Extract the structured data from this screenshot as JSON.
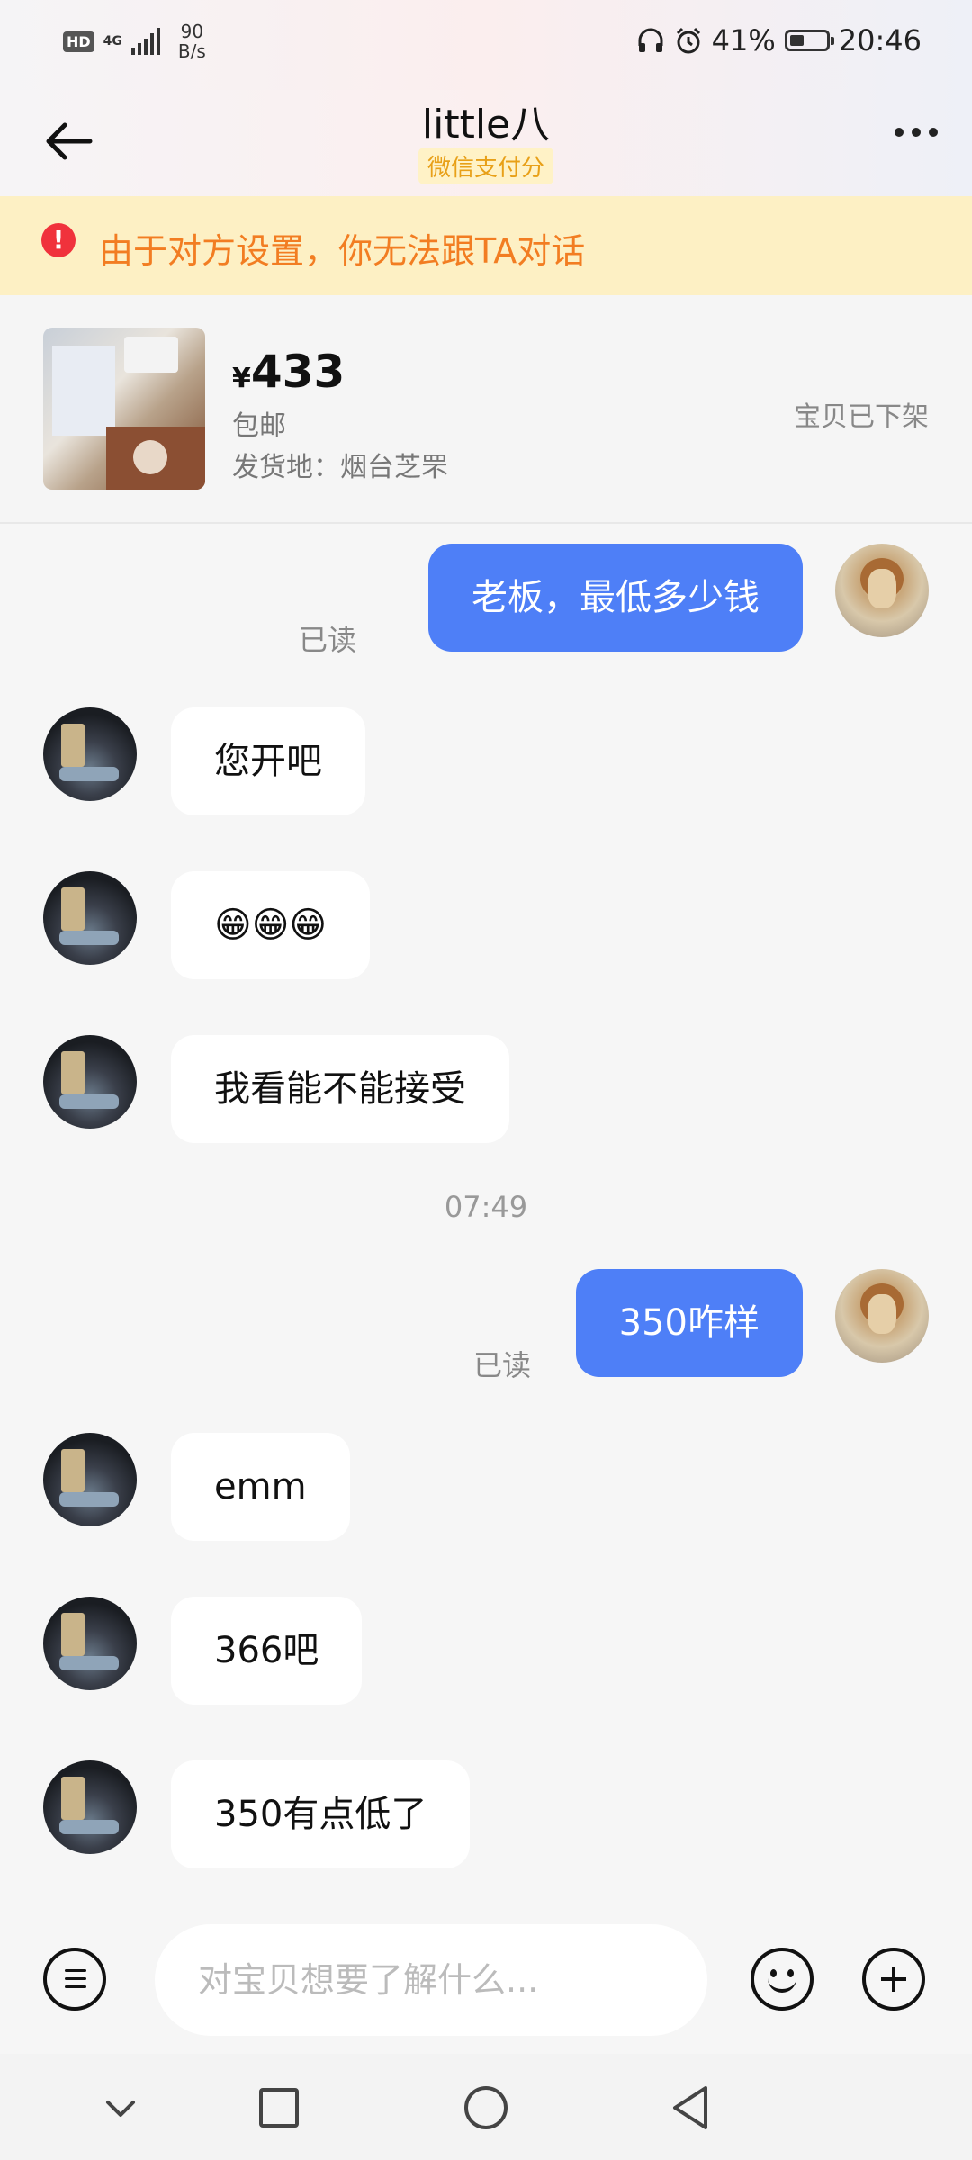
{
  "status_bar": {
    "hd": "HD",
    "network": "4G",
    "speed_value": "90",
    "speed_unit": "B/s",
    "battery_percent": "41%",
    "battery_level": 0.41,
    "time": "20:46"
  },
  "header": {
    "title": "little八",
    "badge": "微信支付分"
  },
  "warning": {
    "icon_text": "!",
    "text": "由于对方设置，你无法跟TA对话"
  },
  "product": {
    "currency": "¥",
    "price": "433",
    "shipping": "包邮",
    "ship_from": "发货地：烟台芝罘",
    "status": "宝贝已下架"
  },
  "messages": [
    {
      "sender": "self",
      "text": "老板，最低多少钱",
      "read": "已读"
    },
    {
      "sender": "other",
      "text": "您开吧"
    },
    {
      "sender": "other",
      "text": "😁😁😁"
    },
    {
      "sender": "other",
      "text": "我看能不能接受"
    },
    {
      "type": "time",
      "text": "07:49"
    },
    {
      "sender": "self",
      "text": "350咋样",
      "read": "已读"
    },
    {
      "sender": "other",
      "text": "emm"
    },
    {
      "sender": "other",
      "text": "366吧"
    },
    {
      "sender": "other",
      "text": "350有点低了"
    }
  ],
  "input": {
    "placeholder": "对宝贝想要了解什么..."
  },
  "icons": {
    "back": "back-arrow-icon",
    "more": "more-dots-icon",
    "menu": "menu-list-icon",
    "emoji": "emoji-icon",
    "plus": "plus-icon",
    "nav_down": "chevron-down-icon",
    "nav_recent": "square-icon",
    "nav_home": "circle-icon",
    "nav_back": "triangle-back-icon"
  },
  "colors": {
    "self_bubble": "#4e7ff7",
    "warning_text": "#f27d22",
    "warning_bg": "#fdf0c4",
    "badge_text": "#e8a018"
  }
}
